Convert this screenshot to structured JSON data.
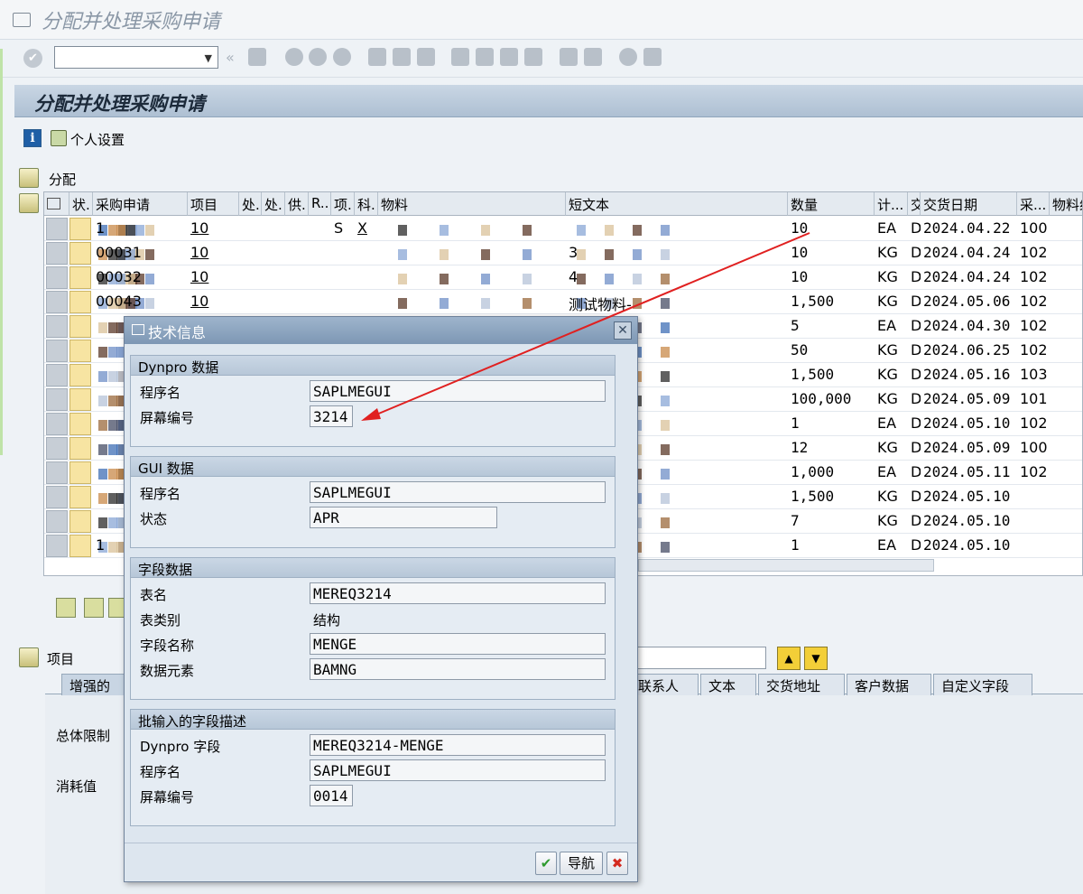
{
  "window": {
    "title": "分配并处理采购申请"
  },
  "toolbar": {
    "command_value": ""
  },
  "header": {
    "title": "分配并处理采购申请",
    "personal_settings": "个人设置",
    "assign_label": "分配"
  },
  "grid": {
    "columns": [
      "状.",
      "采购申请",
      "项目",
      "处.",
      "处.",
      "供.",
      "R..",
      "项.",
      "科.",
      "物料",
      "短文本",
      "数量",
      "计...",
      "交",
      "交货日期",
      "采...",
      "物料组"
    ],
    "rows": [
      {
        "pr": "1",
        "item": "10",
        "itemcat": "S",
        "acct": "X",
        "short": "",
        "qty": "10",
        "unit": "EA",
        "d": "D",
        "date": "2024.04.22",
        "pg": "100"
      },
      {
        "pr": "00031",
        "item": "10",
        "itemcat": "",
        "acct": "",
        "short": "3",
        "qty": "10",
        "unit": "KG",
        "d": "D",
        "date": "2024.04.24",
        "pg": "102"
      },
      {
        "pr": "00032",
        "item": "10",
        "itemcat": "",
        "acct": "",
        "short": "4",
        "qty": "10",
        "unit": "KG",
        "d": "D",
        "date": "2024.04.24",
        "pg": "102"
      },
      {
        "pr": "00043",
        "item": "10",
        "itemcat": "",
        "acct": "",
        "short": "测试物料-",
        "qty": "1,500",
        "unit": "KG",
        "d": "D",
        "date": "2024.05.06",
        "pg": "102"
      },
      {
        "pr": "",
        "item": "",
        "itemcat": "",
        "acct": "",
        "short": "",
        "qty": "5",
        "unit": "EA",
        "d": "D",
        "date": "2024.04.30",
        "pg": "102"
      },
      {
        "pr": "",
        "item": "",
        "itemcat": "",
        "acct": "",
        "short": "",
        "qty": "50",
        "unit": "KG",
        "d": "D",
        "date": "2024.06.25",
        "pg": "102"
      },
      {
        "pr": "",
        "item": "",
        "itemcat": "",
        "acct": "",
        "short": "",
        "qty": "1,500",
        "unit": "KG",
        "d": "D",
        "date": "2024.05.16",
        "pg": "103"
      },
      {
        "pr": "",
        "item": "",
        "itemcat": "",
        "acct": "",
        "short": "",
        "qty": "100,000",
        "unit": "KG",
        "d": "D",
        "date": "2024.05.09",
        "pg": "101"
      },
      {
        "pr": "",
        "item": "",
        "itemcat": "",
        "acct": "",
        "short": "",
        "qty": "1",
        "unit": "EA",
        "d": "D",
        "date": "2024.05.10",
        "pg": "102"
      },
      {
        "pr": "",
        "item": "",
        "itemcat": "",
        "acct": "",
        "short": "",
        "qty": "12",
        "unit": "KG",
        "d": "D",
        "date": "2024.05.09",
        "pg": "100"
      },
      {
        "pr": "",
        "item": "",
        "itemcat": "",
        "acct": "",
        "short": "",
        "qty": "1,000",
        "unit": "EA",
        "d": "D",
        "date": "2024.05.11",
        "pg": "102"
      },
      {
        "pr": "",
        "item": "",
        "itemcat": "",
        "acct": "",
        "short": "",
        "qty": "1,500",
        "unit": "KG",
        "d": "D",
        "date": "2024.05.10",
        "pg": ""
      },
      {
        "pr": "",
        "item": "",
        "itemcat": "",
        "acct": "",
        "short": "",
        "qty": "7",
        "unit": "KG",
        "d": "D",
        "date": "2024.05.10",
        "pg": ""
      },
      {
        "pr": "1",
        "item": "",
        "itemcat": "",
        "acct": "",
        "short": "",
        "qty": "1",
        "unit": "EA",
        "d": "D",
        "date": "2024.05.10",
        "pg": ""
      }
    ]
  },
  "item_section": {
    "label": "项目",
    "left_labels": [
      "总体限制",
      "消耗值"
    ],
    "first_tab": "增强的",
    "tabs": [
      "联系人",
      "文本",
      "交货地址",
      "客户数据",
      "自定义字段"
    ]
  },
  "dialog": {
    "title": "技术信息",
    "groups": [
      {
        "title": "Dynpro 数据",
        "fields": [
          {
            "label": "程序名",
            "value": "SAPLMEGUI"
          },
          {
            "label": "屏幕编号",
            "value": "3214"
          }
        ]
      },
      {
        "title": "GUI 数据",
        "fields": [
          {
            "label": "程序名",
            "value": "SAPLMEGUI"
          },
          {
            "label": "状态",
            "value": "APR"
          }
        ]
      },
      {
        "title": "字段数据",
        "fields": [
          {
            "label": "表名",
            "value": "MEREQ3214"
          },
          {
            "label": "表类别",
            "value": "结构"
          },
          {
            "label": "字段名称",
            "value": "MENGE"
          },
          {
            "label": "数据元素",
            "value": "BAMNG"
          }
        ]
      },
      {
        "title": "批输入的字段描述",
        "fields": [
          {
            "label": "Dynpro 字段",
            "value": "MEREQ3214-MENGE"
          },
          {
            "label": "程序名",
            "value": "SAPLMEGUI"
          },
          {
            "label": "屏幕编号",
            "value": "0014"
          }
        ]
      }
    ],
    "navigate_label": "导航"
  },
  "colors": {
    "header_blue": "#aec0d3",
    "dialog_bg": "#dde6ef",
    "arrow_red": "#e02020",
    "ok_green": "#2e9a2e",
    "cancel_red": "#d42a1f"
  }
}
